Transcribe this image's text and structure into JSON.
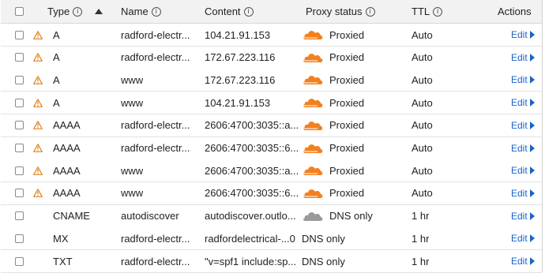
{
  "columns": {
    "type": "Type",
    "name": "Name",
    "content": "Content",
    "proxy_status": "Proxy status",
    "ttl": "TTL",
    "actions": "Actions"
  },
  "colors": {
    "proxied_cloud": "#f38020",
    "dns_only_cloud": "#9a9a9a",
    "warning": "#e0821a",
    "link": "#1a63c9"
  },
  "edit_label": "Edit",
  "rows": [
    {
      "type": "A",
      "name": "radford-electr...",
      "content": "104.21.91.153",
      "proxy": "Proxied",
      "proxied": true,
      "ttl": "Auto",
      "warning": true
    },
    {
      "type": "A",
      "name": "radford-electr...",
      "content": "172.67.223.116",
      "proxy": "Proxied",
      "proxied": true,
      "ttl": "Auto",
      "warning": true
    },
    {
      "type": "A",
      "name": "www",
      "content": "172.67.223.116",
      "proxy": "Proxied",
      "proxied": true,
      "ttl": "Auto",
      "warning": true
    },
    {
      "type": "A",
      "name": "www",
      "content": "104.21.91.153",
      "proxy": "Proxied",
      "proxied": true,
      "ttl": "Auto",
      "warning": true
    },
    {
      "type": "AAAA",
      "name": "radford-electr...",
      "content": "2606:4700:3035::a...",
      "proxy": "Proxied",
      "proxied": true,
      "ttl": "Auto",
      "warning": true
    },
    {
      "type": "AAAA",
      "name": "radford-electr...",
      "content": "2606:4700:3035::6...",
      "proxy": "Proxied",
      "proxied": true,
      "ttl": "Auto",
      "warning": true
    },
    {
      "type": "AAAA",
      "name": "www",
      "content": "2606:4700:3035::a...",
      "proxy": "Proxied",
      "proxied": true,
      "ttl": "Auto",
      "warning": true
    },
    {
      "type": "AAAA",
      "name": "www",
      "content": "2606:4700:3035::6...",
      "proxy": "Proxied",
      "proxied": true,
      "ttl": "Auto",
      "warning": true
    },
    {
      "type": "CNAME",
      "name": "autodiscover",
      "content": "autodiscover.outlo...",
      "proxy": "DNS only",
      "proxied": false,
      "dns_cloud": true,
      "ttl": "1 hr",
      "warning": false
    },
    {
      "type": "MX",
      "name": "radford-electr...",
      "content": "radfordelectrical-...0",
      "proxy": "DNS only",
      "proxied": false,
      "dns_cloud": false,
      "ttl": "1 hr",
      "warning": false
    },
    {
      "type": "TXT",
      "name": "radford-electr...",
      "content": "\"v=spf1 include:sp...",
      "proxy": "DNS only",
      "proxied": false,
      "dns_cloud": false,
      "ttl": "1 hr",
      "warning": false
    }
  ]
}
